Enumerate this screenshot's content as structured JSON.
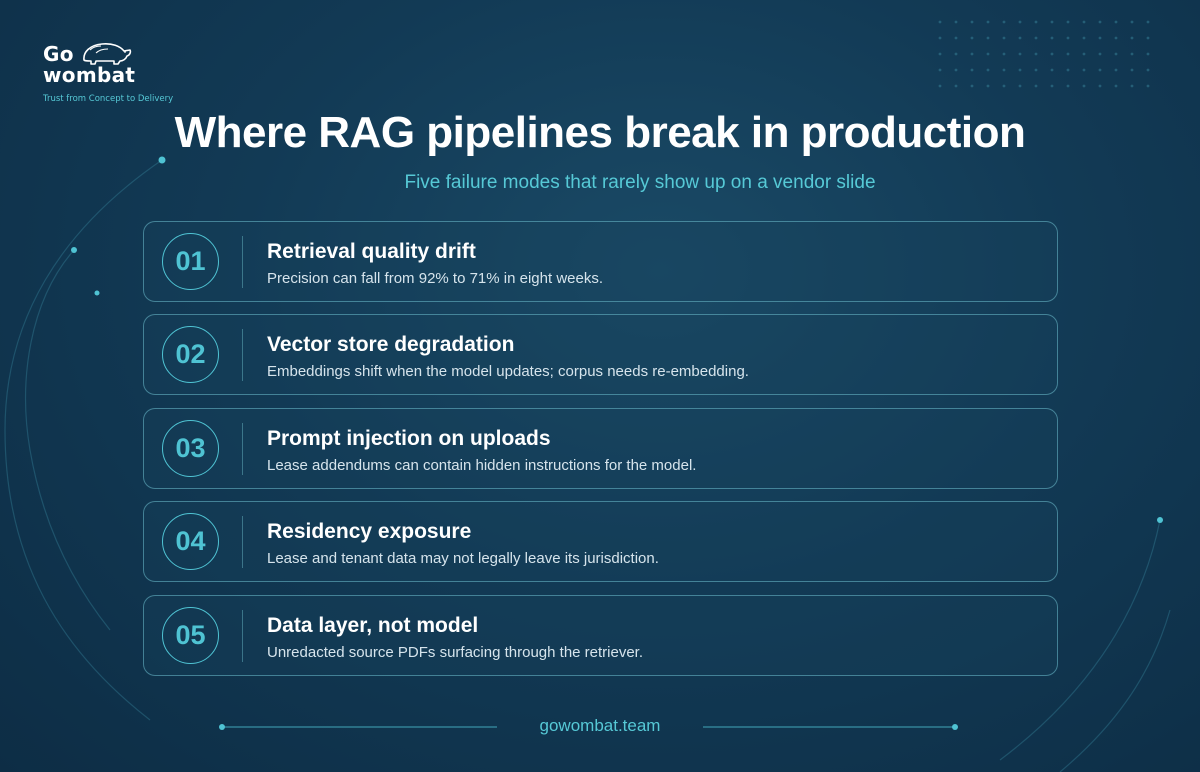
{
  "logo": {
    "line1": "Go",
    "line2": "wombat",
    "tagline": "Trust from Concept to Delivery",
    "icon": "wombat-icon"
  },
  "title": "Where RAG pipelines break in production",
  "subtitle": "Five failure modes that rarely show up on a vendor slide",
  "items": [
    {
      "number": "01",
      "title": "Retrieval quality drift",
      "description": "Precision can fall from 92% to 71% in eight weeks."
    },
    {
      "number": "02",
      "title": "Vector store degradation",
      "description": "Embeddings shift when the model updates; corpus needs re-embedding."
    },
    {
      "number": "03",
      "title": "Prompt injection on uploads",
      "description": "Lease addendums can contain hidden instructions for the model."
    },
    {
      "number": "04",
      "title": "Residency exposure",
      "description": "Lease and tenant data may not legally leave its jurisdiction."
    },
    {
      "number": "05",
      "title": "Data layer, not model",
      "description": "Unredacted source PDFs surfacing through the retriever."
    }
  ],
  "footer": "gowombat.team",
  "colors": {
    "background": "#123a55",
    "accent": "#4fc3d3",
    "text": "#ffffff"
  }
}
